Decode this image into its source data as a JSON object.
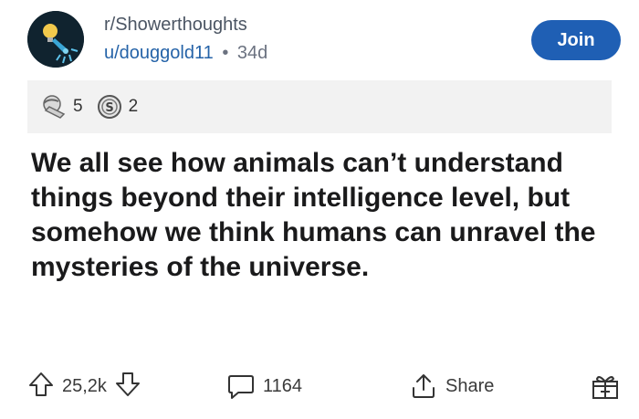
{
  "post": {
    "subreddit": "r/Showerthoughts",
    "username": "u/douggold11",
    "separator": "•",
    "age": "34d",
    "join_label": "Join",
    "awards": [
      {
        "icon": "facepalm-award-icon",
        "count": "5"
      },
      {
        "icon": "silver-award-icon",
        "count": "2"
      }
    ],
    "title": "We all see how animals can’t understand things beyond their intelligence level, but somehow we think humans can unravel the mysteries of the universe."
  },
  "actions": {
    "votes": "25,2k",
    "comments": "1164",
    "share_label": "Share"
  },
  "colors": {
    "join_bg": "#1f5fb4",
    "username": "#2563a8",
    "award_bar": "#f2f2f2"
  }
}
